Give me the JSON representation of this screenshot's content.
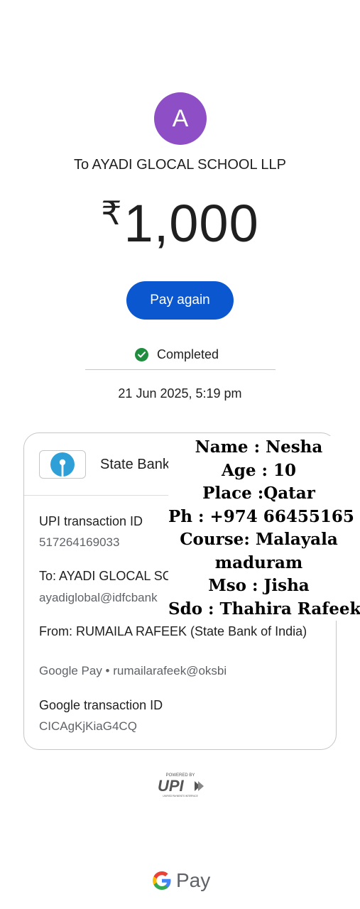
{
  "avatar": {
    "letter": "A",
    "color": "#8e4ec6"
  },
  "payee": "To AYADI GLOCAL SCHOOL LLP",
  "amount": {
    "currency": "₹",
    "value": "1,000"
  },
  "actions": {
    "pay_again": "Pay again"
  },
  "status": {
    "text": "Completed",
    "icon": "check-circle-icon",
    "color": "#1e8e3e"
  },
  "datetime": "21 Jun 2025, 5:19 pm",
  "details": {
    "bank": {
      "name": "State Bank of ...",
      "icon": "sbi-logo"
    },
    "upi_id_label": "UPI transaction ID",
    "upi_id_value": "517264169033",
    "to_label": "To: AYADI GLOCAL SCHOC",
    "to_value": "ayadiglobal@idfcbank",
    "from_label": "From: RUMAILA  RAFEEK (State Bank of India)",
    "from_value": "Google Pay • rumailarafeek@oksbi",
    "google_id_label": "Google transaction ID",
    "google_id_value": "CICAgKjKiaG4CQ"
  },
  "overlay_lines": [
    "Name : Nesha",
    "Age : 10",
    "Place :Qatar",
    "Ph : +974 66455165",
    "Course: Malayala",
    "maduram",
    "Mso : Jisha",
    "Sdo : Thahira Rafeek"
  ],
  "footer": {
    "powered_by": "POWERED BY",
    "upi": "UPI",
    "upi_tagline": "UNIFIED PAYMENTS INTERFACE",
    "gpay_g": "G",
    "gpay_text": "Pay"
  },
  "colors": {
    "primary": "#0b57d0",
    "border": "#c4c7c5"
  }
}
